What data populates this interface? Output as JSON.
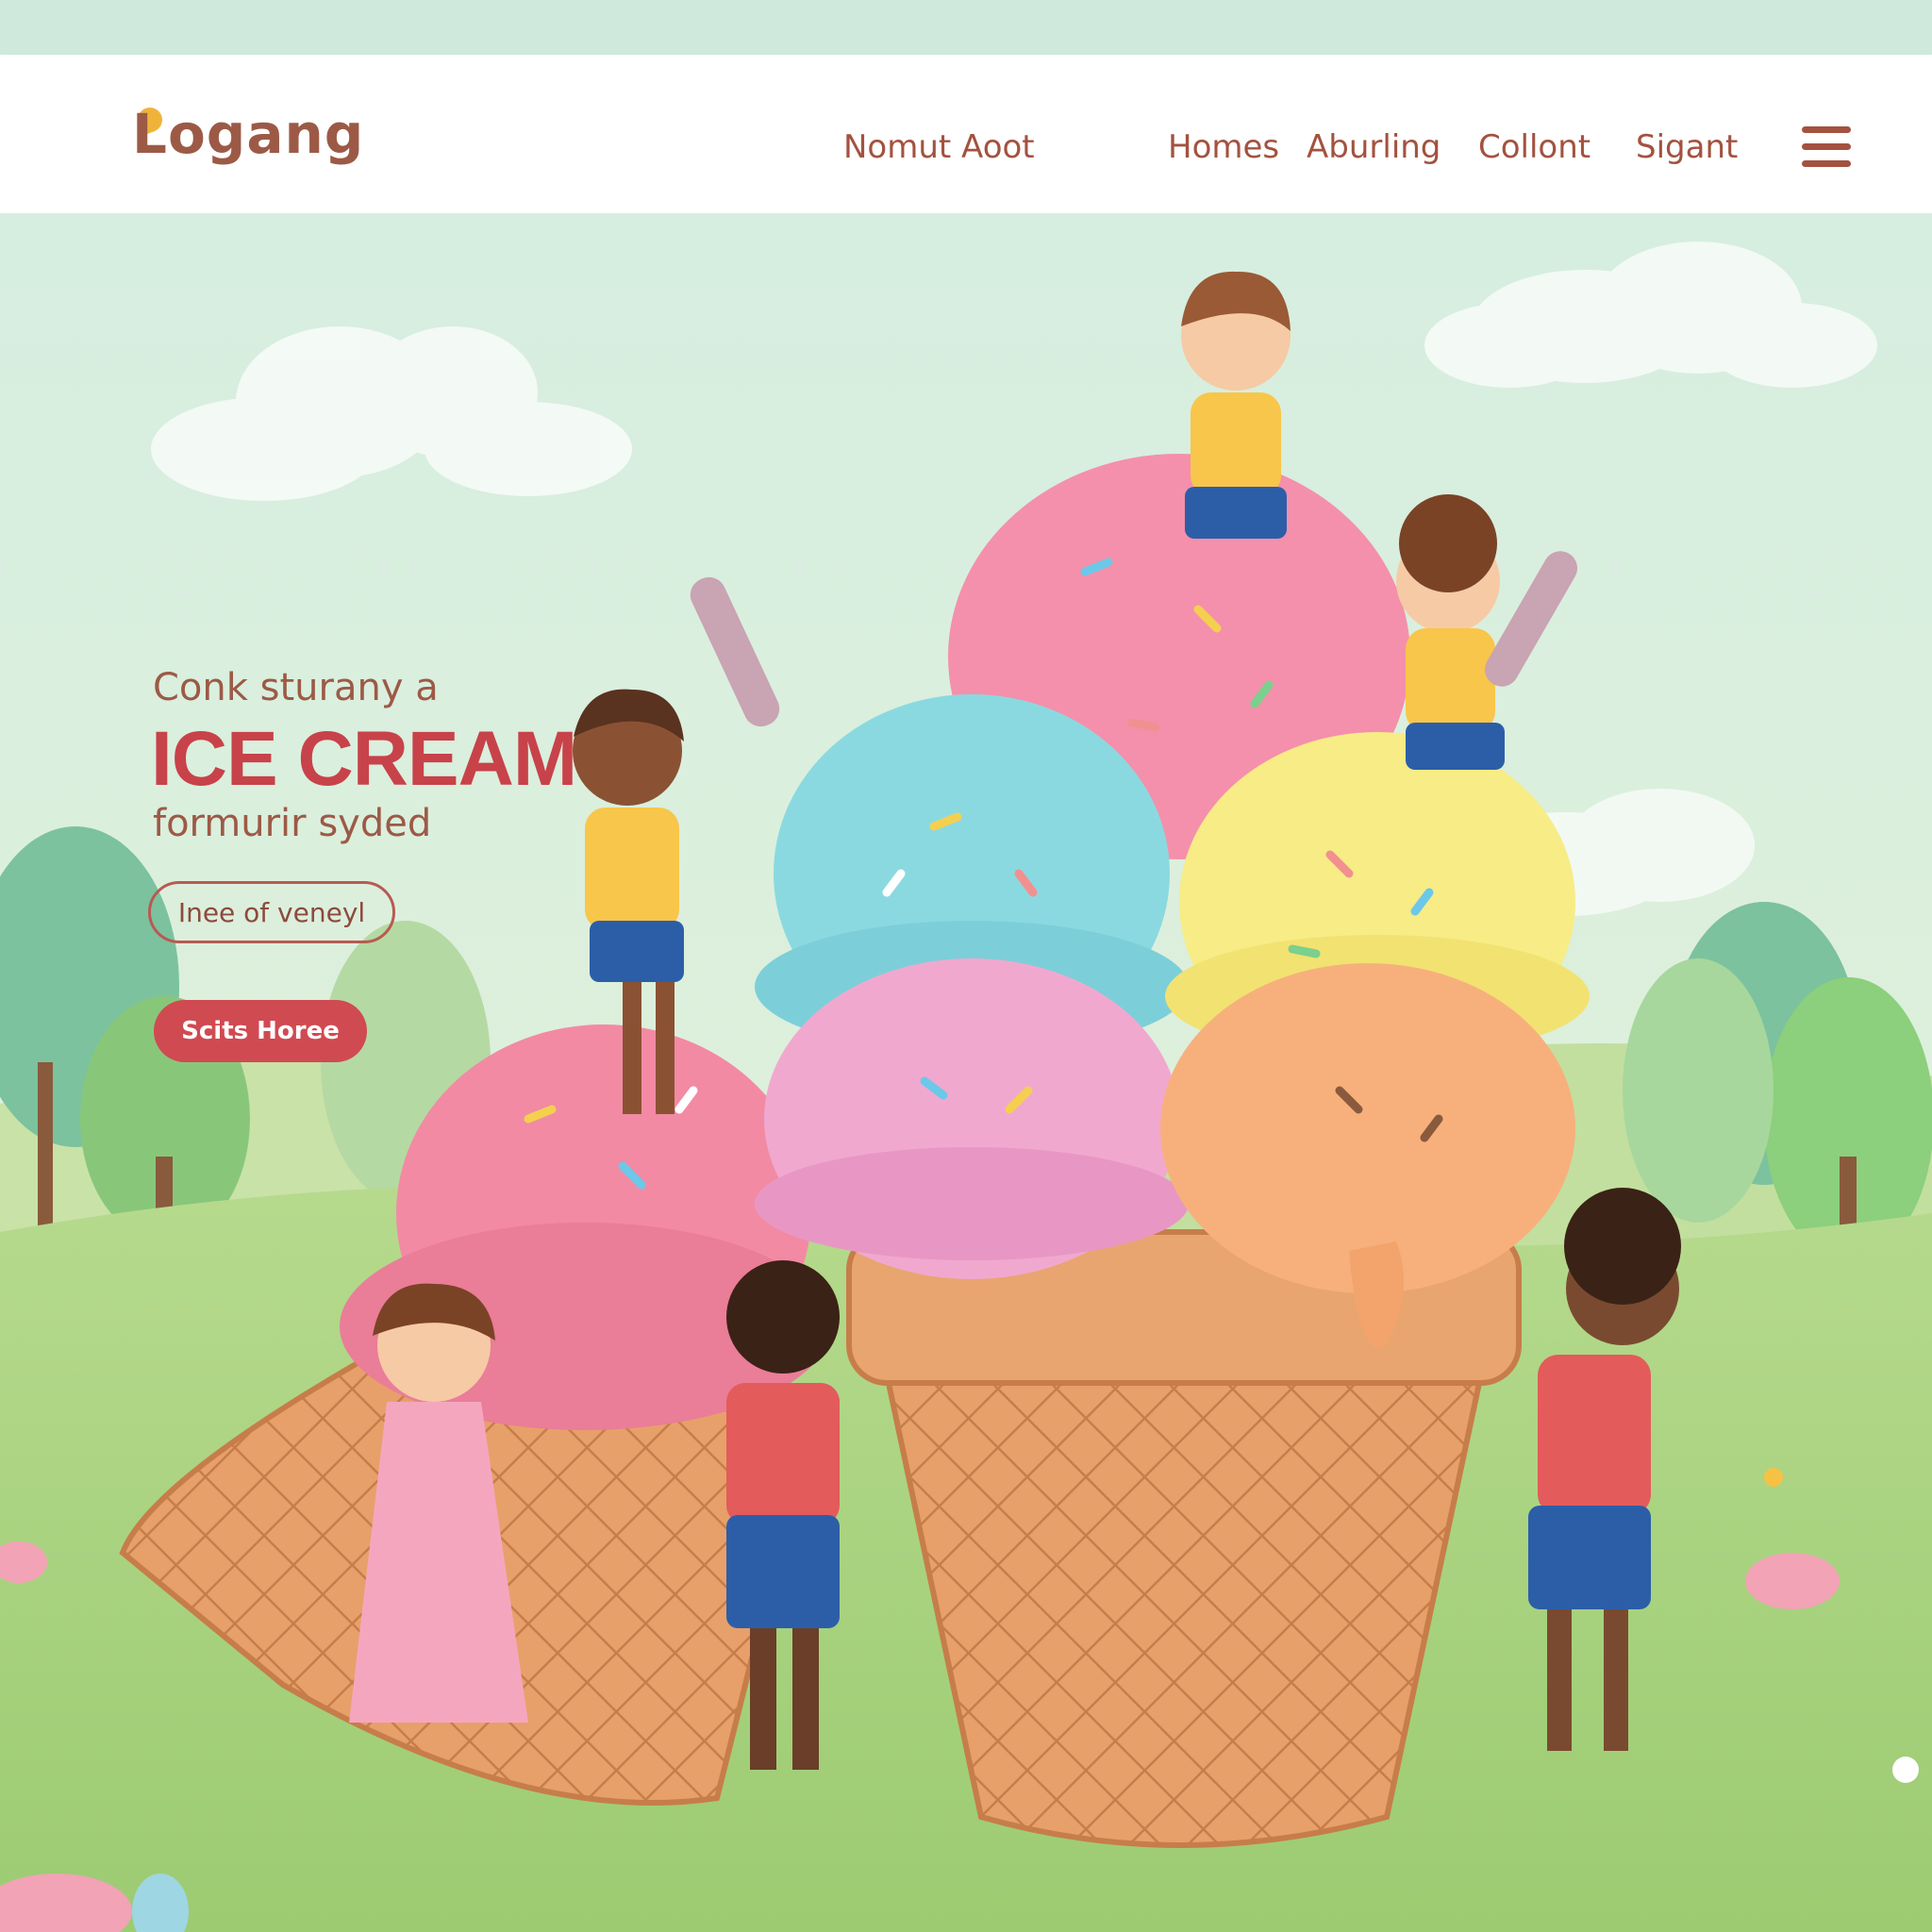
{
  "header": {
    "logo_text": "Logang",
    "nav": [
      {
        "label": "Nomut Aoot"
      },
      {
        "label": "Homes"
      },
      {
        "label": "Aburling"
      },
      {
        "label": "Collont"
      },
      {
        "label": "Sigant"
      }
    ],
    "menu_icon": "hamburger-menu-icon"
  },
  "hero": {
    "kicker": "Conk sturany a",
    "title": "ICE CREAM",
    "subtitle": "formurir syded",
    "outline_button": "Inee of veneyl",
    "primary_button": "Scits Horee"
  },
  "colors": {
    "accent_red": "#c8424a",
    "brand_brown": "#9c5a46",
    "sky": "#d8efe3",
    "grass": "#a9d27e"
  }
}
